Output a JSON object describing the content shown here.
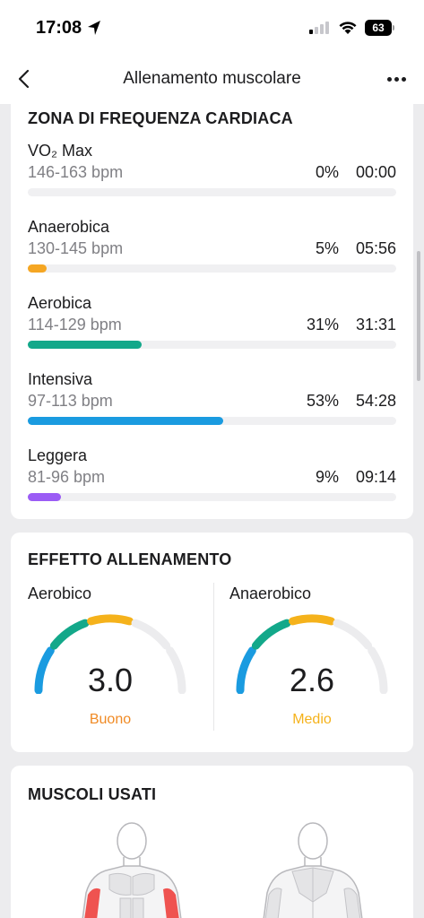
{
  "status_bar": {
    "time": "17:08",
    "battery": "63"
  },
  "nav": {
    "title": "Allenamento muscolare"
  },
  "heart_rate_zones": {
    "title": "ZONA DI FREQUENZA CARDIACA",
    "zones": [
      {
        "name": "VO₂ Max",
        "range": "146-163 bpm",
        "percent": "0%",
        "time": "00:00",
        "fill": 0,
        "color": "#8e8e93"
      },
      {
        "name": "Anaerobica",
        "range": "130-145 bpm",
        "percent": "5%",
        "time": "05:56",
        "fill": 0.05,
        "color": "#f5a623"
      },
      {
        "name": "Aerobica",
        "range": "114-129 bpm",
        "percent": "31%",
        "time": "31:31",
        "fill": 0.31,
        "color": "#13a88a"
      },
      {
        "name": "Intensiva",
        "range": "97-113 bpm",
        "percent": "53%",
        "time": "54:28",
        "fill": 0.53,
        "color": "#1a9be0"
      },
      {
        "name": "Leggera",
        "range": "81-96 bpm",
        "percent": "9%",
        "time": "09:14",
        "fill": 0.09,
        "color": "#9b5cf5"
      }
    ]
  },
  "training_effect": {
    "title": "EFFETTO ALLENAMENTO",
    "aerobic": {
      "label": "Aerobico",
      "value": "3.0",
      "level": 3.0,
      "status": "Buono",
      "status_color": "#f08a24"
    },
    "anaerobic": {
      "label": "Anaerobico",
      "value": "2.6",
      "level": 2.6,
      "status": "Medio",
      "status_color": "#f5b21b"
    },
    "segment_colors": [
      "#1a9be0",
      "#13a88a",
      "#f5b21b",
      "#ececee",
      "#ececee"
    ]
  },
  "muscles": {
    "title": "MUSCOLI USATI"
  }
}
